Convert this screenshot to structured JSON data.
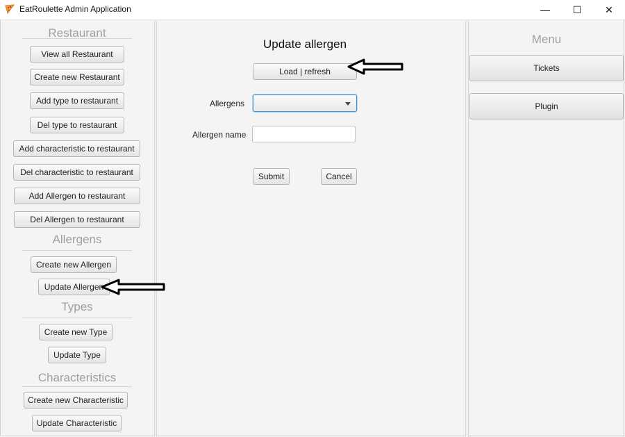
{
  "window": {
    "title": "EatRoulette Admin Application",
    "minimize_glyph": "—",
    "maximize_glyph": "☐",
    "close_glyph": "✕"
  },
  "sidebar": {
    "sections": [
      {
        "title": "Restaurant",
        "buttons": [
          "View all Restaurant",
          "Create new Restaurant",
          "Add type to restaurant",
          "Del type to restaurant",
          "Add characteristic to restaurant",
          "Del characteristic to restaurant",
          "Add Allergen to restaurant",
          "Del Allergen to restaurant"
        ]
      },
      {
        "title": "Allergens",
        "buttons": [
          "Create new Allergen",
          "Update Allergen"
        ]
      },
      {
        "title": "Types",
        "buttons": [
          "Create new Type",
          "Update Type"
        ]
      },
      {
        "title": "Characteristics",
        "buttons": [
          "Create new Characteristic",
          "Update Characteristic"
        ]
      }
    ]
  },
  "main": {
    "title": "Update allergen",
    "load_button": "Load | refresh",
    "allergens_label": "Allergens",
    "allergens_value": "",
    "allergen_name_label": "Allergen name",
    "allergen_name_value": "",
    "submit_button": "Submit",
    "cancel_button": "Cancel"
  },
  "menu": {
    "title": "Menu",
    "tickets_button": "Tickets",
    "plugin_button": "Plugin"
  },
  "icons": {
    "app_icon": "pizza-slice-icon",
    "annotation": "left-arrow-icon"
  }
}
